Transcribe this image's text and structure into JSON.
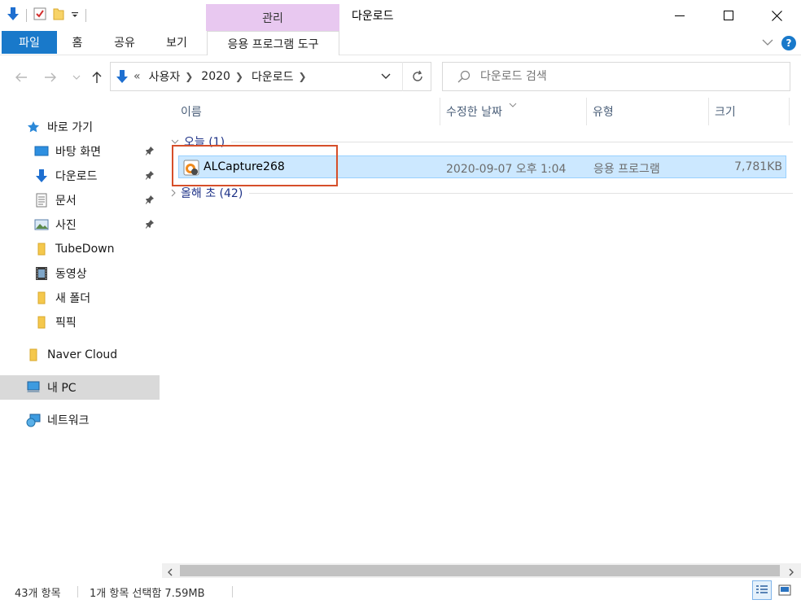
{
  "window": {
    "title": "다운로드",
    "manage_tab": "관리"
  },
  "ribbon": {
    "file": "파일",
    "home": "홈",
    "share": "공유",
    "view": "보기",
    "app_tools": "응용 프로그램 도구"
  },
  "address": {
    "overflow": "«",
    "crumbs": [
      "사용자",
      "2020",
      "다운로드"
    ]
  },
  "search": {
    "placeholder": "다운로드 검색"
  },
  "sidebar": {
    "items": [
      {
        "label": "바로 가기",
        "icon": "star-icon"
      },
      {
        "label": "바탕 화면",
        "icon": "desktop-icon",
        "pinned": true
      },
      {
        "label": "다운로드",
        "icon": "download-arrow-icon",
        "pinned": true
      },
      {
        "label": "문서",
        "icon": "document-icon",
        "pinned": true
      },
      {
        "label": "사진",
        "icon": "picture-icon",
        "pinned": true
      },
      {
        "label": "TubeDown",
        "icon": "folder-icon"
      },
      {
        "label": "동영상",
        "icon": "film-icon"
      },
      {
        "label": "새 폴더",
        "icon": "folder-icon"
      },
      {
        "label": "픽픽",
        "icon": "folder-icon"
      },
      {
        "label": "Naver Cloud",
        "icon": "folder-icon"
      },
      {
        "label": "내 PC",
        "icon": "computer-icon",
        "selected": true
      },
      {
        "label": "네트워크",
        "icon": "network-icon"
      }
    ]
  },
  "columns": {
    "name": "이름",
    "modified": "수정한 날짜",
    "type": "유형",
    "size": "크기"
  },
  "groups": {
    "today": "오늘 (1)",
    "early_this_year": "올해 초 (42)"
  },
  "files": [
    {
      "name": "ALCapture268",
      "modified": "2020-09-07 오후 1:04",
      "type": "응용 프로그램",
      "size": "7,781KB",
      "icon": "alcapture-app-icon"
    }
  ],
  "status": {
    "item_count": "43개 항목",
    "selection": "1개 항목 선택함 7.59MB"
  },
  "colors": {
    "accent": "#1979ca",
    "manage_tab": "#e8c8f0",
    "selection_fill": "#cce8ff",
    "selection_border": "#99d1ff",
    "annotation_box": "#d64f2a",
    "group_text": "#1e3287"
  }
}
